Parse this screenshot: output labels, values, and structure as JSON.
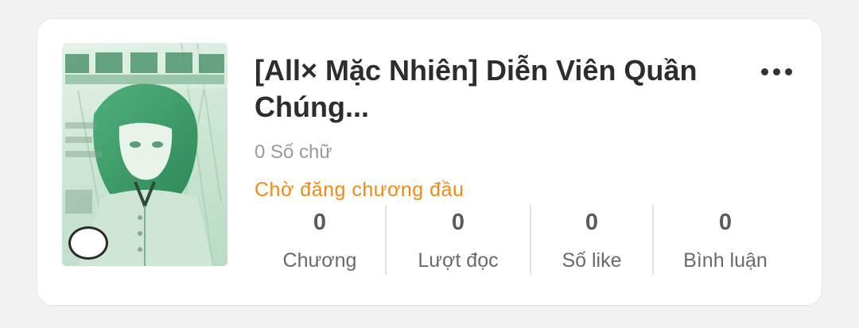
{
  "book": {
    "title": "[All× Mặc Nhiên] Diễn Viên Quần Chúng...",
    "word_count": "0 Số chữ",
    "status": "Chờ đăng chương đầu",
    "status_color": "#f08a14",
    "cover_icon": "book-cover-image",
    "menu_icon": "more-dots-icon"
  },
  "stats": [
    {
      "value": "0",
      "label": "Chương"
    },
    {
      "value": "0",
      "label": "Lượt đọc"
    },
    {
      "value": "0",
      "label": "Số like"
    },
    {
      "value": "0",
      "label": "Bình luận"
    }
  ]
}
